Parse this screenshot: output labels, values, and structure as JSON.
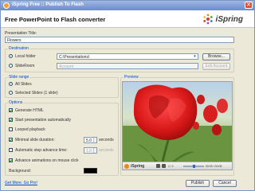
{
  "window": {
    "title": "iSpring Free :: Publish To Flash",
    "close_glyph": "✕"
  },
  "header": {
    "heading": "Free PowerPoint to Flash converter",
    "logo_text": "iSpring"
  },
  "presentation_title": {
    "label": "Presentation Title:",
    "value": "Flowers"
  },
  "destination": {
    "legend": "Destination",
    "local_folder_label": "Local folder",
    "local_folder_value": "C:\\Presentations\\",
    "browse_label": "Browse...",
    "slideroom_label": "SlideRoom",
    "account_placeholder": "Account",
    "edit_account_label": "Edit Account"
  },
  "slide_range": {
    "legend": "Slide range",
    "all_slides_label": "All Slides",
    "selected_slides_label": "Selected Slides (1 slide)"
  },
  "options": {
    "legend": "Options",
    "generate_html": "Generate HTML",
    "start_auto": "Start presentation automatically",
    "looped": "Looped playback",
    "min_duration_label": "Minimal slide duration:",
    "min_duration_value": "5.0",
    "min_duration_unit": "seconds",
    "auto_step_label": "Automatic step advance time:",
    "auto_step_value": "1.0",
    "auto_step_unit": "seconds",
    "advance_click": "Advance animations on mouse click",
    "background_label": "Background:",
    "background_color": "#000000"
  },
  "preview": {
    "legend": "Preview",
    "player_brand": "iSpring",
    "counter": "1 / 1",
    "time": "00:00 / 00:05"
  },
  "footer": {
    "link": "Get More. Go Pro!",
    "publish_label": "Publish",
    "cancel_label": "Cancel"
  },
  "colors": {
    "accent": "#0046d5",
    "titlebar": "#6b8cc9",
    "check_mark": "#21a121"
  },
  "icons": {
    "app": "ispring-app-icon",
    "logo": "ispring-spark-icon",
    "close": "close-icon"
  }
}
